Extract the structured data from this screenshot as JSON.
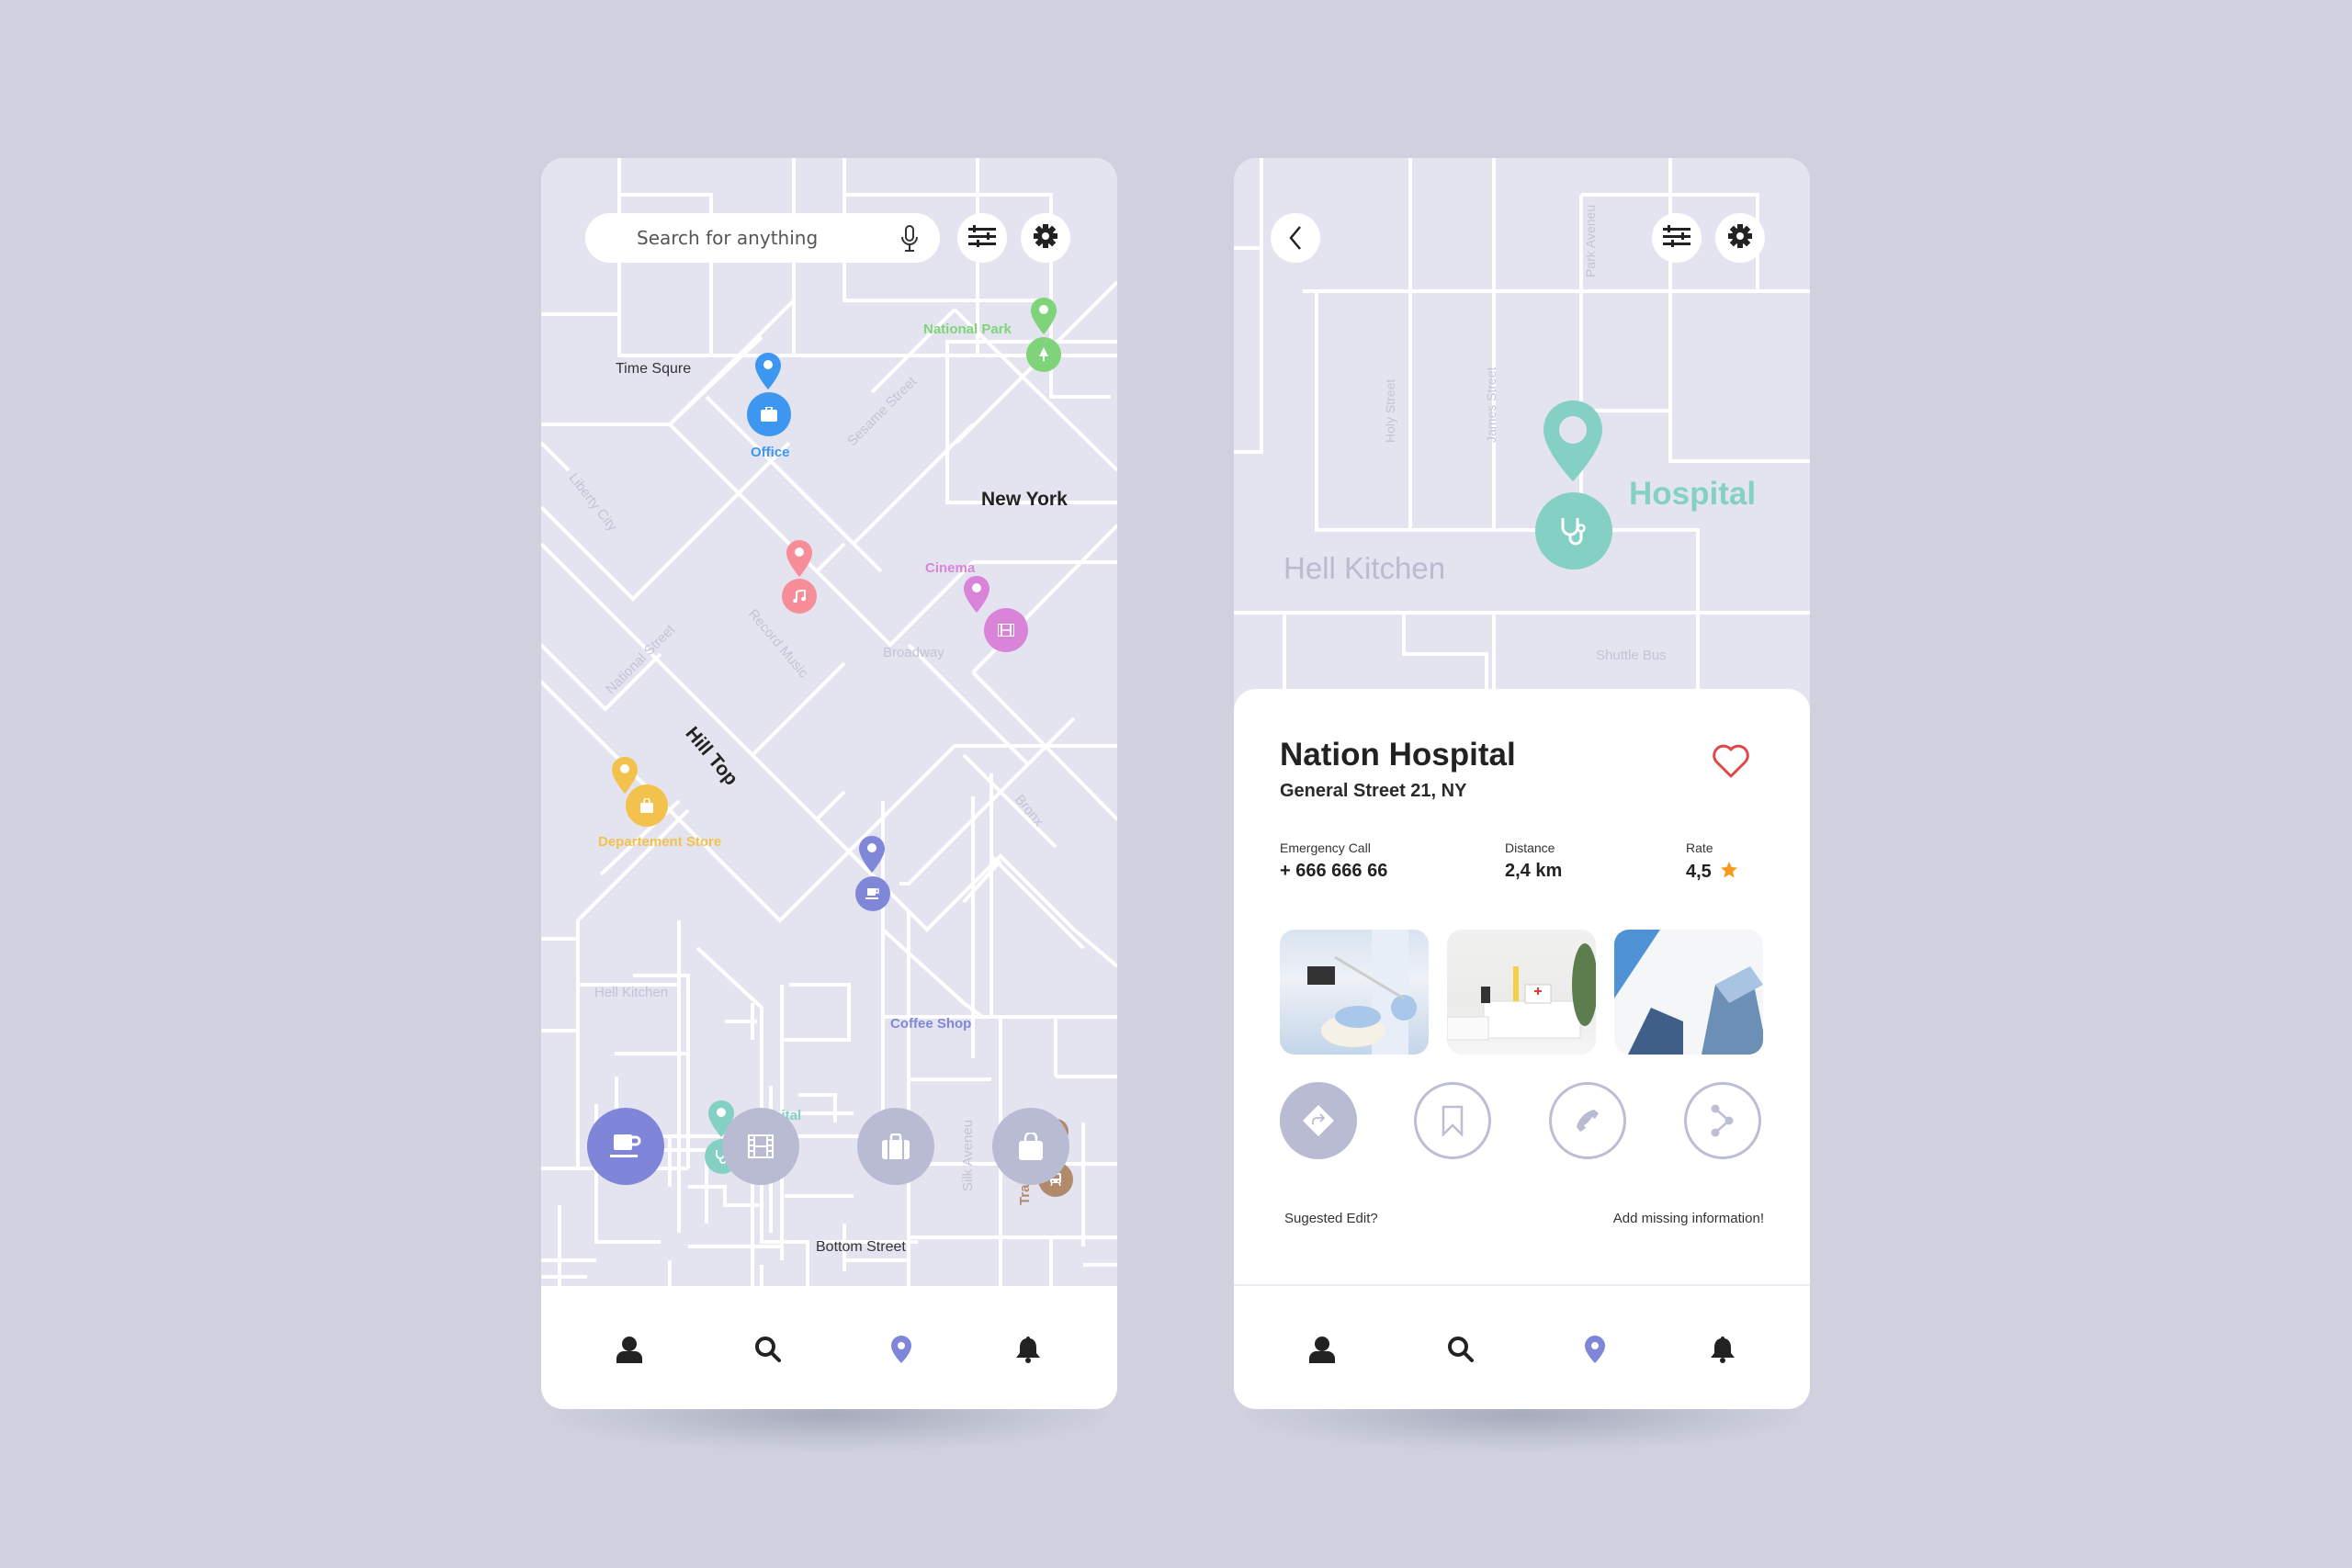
{
  "colors": {
    "background": "#cfd1de",
    "map_bg": "#e4e4f0",
    "street": "#ffffff",
    "accent": "#7f85d8",
    "office": "#3d97f0",
    "park": "#7fd47a",
    "music": "#f78d98",
    "cinema": "#d984d9",
    "store": "#f3c24c",
    "coffee": "#8187d8",
    "hospital": "#85d0c4",
    "train": "#b08a6b",
    "heart": "#e04848",
    "star": "#f59a1b"
  },
  "left_screen": {
    "search": {
      "placeholder": "Search for anything",
      "value": "",
      "mic_icon": "microphone-icon"
    },
    "filter_icon": "sliders-icon",
    "settings_icon": "gear-icon",
    "map_labels": {
      "time_square": "Time Squre",
      "new_york": "New York",
      "hill_top": "Hill Top",
      "sesame_street": "Sesame Street",
      "liberty_city": "Liberty City",
      "national_street": "National Street",
      "record_music": "Record Music",
      "broadway": "Broadway",
      "bronx": "Bronx",
      "hell_kitchen": "Hell Kitchen",
      "silk_avenue": "Silk Aveneu",
      "bottom_street": "Bottom Street"
    },
    "pois": [
      {
        "name": "Office",
        "icon": "briefcase-icon"
      },
      {
        "name": "National Park",
        "icon": "tree-icon"
      },
      {
        "name": "",
        "icon": "music-note-icon"
      },
      {
        "name": "Cinema",
        "icon": "film-icon"
      },
      {
        "name": "Departement Store",
        "icon": "shopping-bag-icon"
      },
      {
        "name": "Coffee Shop",
        "icon": "coffee-cup-icon"
      },
      {
        "name": "Hospital",
        "icon": "stethoscope-icon"
      },
      {
        "name": "Train Station",
        "icon": "train-icon"
      }
    ],
    "categories": [
      {
        "id": "coffee",
        "icon": "coffee-cup-icon",
        "active": true
      },
      {
        "id": "cinema",
        "icon": "film-icon",
        "active": false
      },
      {
        "id": "office",
        "icon": "briefcase-icon",
        "active": false
      },
      {
        "id": "shopping",
        "icon": "shopping-bag-icon",
        "active": false
      }
    ],
    "bottom_nav": [
      {
        "id": "profile",
        "icon": "user-icon",
        "active": false
      },
      {
        "id": "search",
        "icon": "search-icon",
        "active": false
      },
      {
        "id": "map",
        "icon": "location-pin-icon",
        "active": true
      },
      {
        "id": "notifications",
        "icon": "bell-icon",
        "active": false
      }
    ]
  },
  "right_screen": {
    "back_icon": "chevron-left-icon",
    "filter_icon": "sliders-icon",
    "settings_icon": "gear-icon",
    "map_labels": {
      "park_avenue": "Park Aveneu",
      "holy_street": "Holy Street",
      "james_street": "James Street",
      "hell_kitchen": "Hell Kitchen",
      "shuttle_bus": "Shuttle Bus",
      "hospital": "Hospital"
    },
    "place": {
      "title": "Nation Hospital",
      "address": "General Street 21, NY",
      "favorite": false,
      "stats": [
        {
          "label": "Emergency Call",
          "value": "+ 666 666 66"
        },
        {
          "label": "Distance",
          "value": "2,4 km"
        },
        {
          "label": "Rate",
          "value": "4,5"
        }
      ],
      "rating": 4.5,
      "photos": [
        "dental-clinic-photo",
        "medical-room-photo",
        "skyscraper-photo"
      ]
    },
    "actions": [
      {
        "id": "directions",
        "icon": "directions-icon",
        "filled": true
      },
      {
        "id": "save",
        "icon": "bookmark-icon",
        "filled": false
      },
      {
        "id": "call",
        "icon": "phone-icon",
        "filled": false
      },
      {
        "id": "share",
        "icon": "share-icon",
        "filled": false
      }
    ],
    "links": {
      "suggest_edit": "Sugested Edit?",
      "add_info": "Add missing information!"
    },
    "bottom_nav": [
      {
        "id": "profile",
        "icon": "user-icon",
        "active": false
      },
      {
        "id": "search",
        "icon": "search-icon",
        "active": false
      },
      {
        "id": "map",
        "icon": "location-pin-icon",
        "active": true
      },
      {
        "id": "notifications",
        "icon": "bell-icon",
        "active": false
      }
    ]
  }
}
